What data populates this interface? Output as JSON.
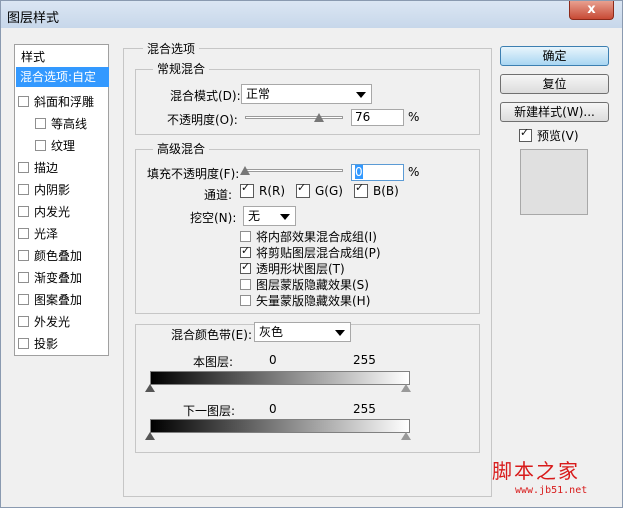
{
  "window": {
    "title": "图层样式",
    "close_label": "x"
  },
  "sidebar": {
    "title": "样式",
    "items": [
      {
        "label": "混合选项:自定",
        "checked": false,
        "active": true
      },
      {
        "label": "斜面和浮雕",
        "checked": false
      },
      {
        "label": "等高线",
        "checked": false
      },
      {
        "label": "纹理",
        "checked": false
      },
      {
        "label": "描边",
        "checked": false
      },
      {
        "label": "内阴影",
        "checked": false
      },
      {
        "label": "内发光",
        "checked": false
      },
      {
        "label": "光泽",
        "checked": false
      },
      {
        "label": "颜色叠加",
        "checked": false
      },
      {
        "label": "渐变叠加",
        "checked": false
      },
      {
        "label": "图案叠加",
        "checked": false
      },
      {
        "label": "外发光",
        "checked": false
      },
      {
        "label": "投影",
        "checked": false
      }
    ]
  },
  "blend_options": {
    "title": "混合选项",
    "general": {
      "title": "常规混合",
      "mode_label": "混合模式(D):",
      "mode_value": "正常",
      "opacity_label": "不透明度(O):",
      "opacity_value": "76",
      "opacity_fraction": 0.76,
      "percent": "%"
    },
    "advanced": {
      "title": "高级混合",
      "fill_label": "填充不透明度(F):",
      "fill_value": "0",
      "fill_fraction": 0,
      "percent": "%",
      "channels_label": "通道:",
      "channel_r": "R(R)",
      "channel_g": "G(G)",
      "channel_b": "B(B)",
      "knockout_label": "挖空(N):",
      "knockout_value": "无",
      "options": [
        {
          "label": "将内部效果混合成组(I)",
          "checked": false
        },
        {
          "label": "将剪贴图层混合成组(P)",
          "checked": true
        },
        {
          "label": "透明形状图层(T)",
          "checked": true
        },
        {
          "label": "图层蒙版隐藏效果(S)",
          "checked": false
        },
        {
          "label": "矢量蒙版隐藏效果(H)",
          "checked": false
        }
      ]
    },
    "blend_if": {
      "label": "混合颜色带(E):",
      "value": "灰色",
      "this_layer": "本图层:",
      "underlying_layer": "下一图层:",
      "min": "0",
      "max": "255"
    }
  },
  "buttons": {
    "ok": "确定",
    "reset": "复位",
    "new_style": "新建样式(W)...",
    "preview": "预览(V)"
  },
  "watermark": {
    "line1": "脚本之家",
    "line2": "www.jb51.net"
  }
}
